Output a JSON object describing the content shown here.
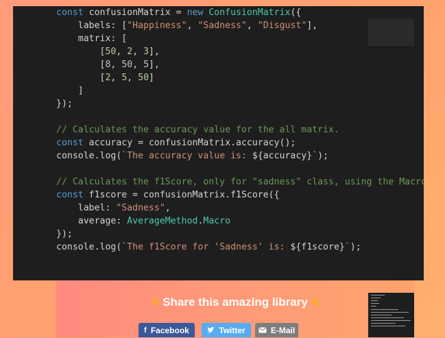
{
  "code": {
    "lines": [
      [
        {
          "t": "const",
          "c": "#569cd6"
        },
        {
          "t": " confusionMatrix = ",
          "c": "#d4d4d4"
        },
        {
          "t": "new",
          "c": "#569cd6"
        },
        {
          "t": " ",
          "c": "#d4d4d4"
        },
        {
          "t": "ConfusionMatrix",
          "c": "#4ec9b0"
        },
        {
          "t": "({",
          "c": "#d4d4d4"
        }
      ],
      [
        {
          "t": "    labels: [",
          "c": "#d4d4d4"
        },
        {
          "t": "\"Happiness\"",
          "c": "#ce9178"
        },
        {
          "t": ", ",
          "c": "#d4d4d4"
        },
        {
          "t": "\"Sadness\"",
          "c": "#ce9178"
        },
        {
          "t": ", ",
          "c": "#d4d4d4"
        },
        {
          "t": "\"Disgust\"",
          "c": "#ce9178"
        },
        {
          "t": "],",
          "c": "#d4d4d4"
        }
      ],
      [
        {
          "t": "    matrix: [",
          "c": "#d4d4d4"
        }
      ],
      [
        {
          "t": "        [",
          "c": "#d4d4d4"
        },
        {
          "t": "50",
          "c": "#b5cea8"
        },
        {
          "t": ", ",
          "c": "#d4d4d4"
        },
        {
          "t": "2",
          "c": "#b5cea8"
        },
        {
          "t": ", ",
          "c": "#d4d4d4"
        },
        {
          "t": "3",
          "c": "#b5cea8"
        },
        {
          "t": "],",
          "c": "#d4d4d4"
        }
      ],
      [
        {
          "t": "        [",
          "c": "#d4d4d4"
        },
        {
          "t": "8",
          "c": "#b5cea8"
        },
        {
          "t": ", ",
          "c": "#d4d4d4"
        },
        {
          "t": "50",
          "c": "#b5cea8"
        },
        {
          "t": ", ",
          "c": "#d4d4d4"
        },
        {
          "t": "5",
          "c": "#b5cea8"
        },
        {
          "t": "],",
          "c": "#d4d4d4"
        }
      ],
      [
        {
          "t": "        [",
          "c": "#d4d4d4"
        },
        {
          "t": "2",
          "c": "#b5cea8"
        },
        {
          "t": ", ",
          "c": "#d4d4d4"
        },
        {
          "t": "5",
          "c": "#b5cea8"
        },
        {
          "t": ", ",
          "c": "#d4d4d4"
        },
        {
          "t": "50",
          "c": "#b5cea8"
        },
        {
          "t": "]",
          "c": "#d4d4d4"
        }
      ],
      [
        {
          "t": "    ]",
          "c": "#d4d4d4"
        }
      ],
      [
        {
          "t": "});",
          "c": "#d4d4d4"
        }
      ],
      [],
      [
        {
          "t": "// Calculates the accuracy value for the all matrix.",
          "c": "#6a9955"
        }
      ],
      [
        {
          "t": "const",
          "c": "#569cd6"
        },
        {
          "t": " accuracy = confusionMatrix.accuracy();",
          "c": "#d4d4d4"
        }
      ],
      [
        {
          "t": "console.log(",
          "c": "#d4d4d4"
        },
        {
          "t": "`The accuracy value is: ",
          "c": "#ce9178"
        },
        {
          "t": "${accuracy}",
          "c": "#d4d4d4"
        },
        {
          "t": "`",
          "c": "#ce9178"
        },
        {
          "t": ");",
          "c": "#d4d4d4"
        }
      ],
      [],
      [
        {
          "t": "// Calculates the f1Score, only for \"sadness\" class, using the Macro",
          "c": "#6a9955"
        }
      ],
      [
        {
          "t": "const",
          "c": "#569cd6"
        },
        {
          "t": " f1score = confusionMatrix.f1Score({",
          "c": "#d4d4d4"
        }
      ],
      [
        {
          "t": "    label: ",
          "c": "#d4d4d4"
        },
        {
          "t": "\"Sadness\"",
          "c": "#ce9178"
        },
        {
          "t": ",",
          "c": "#d4d4d4"
        }
      ],
      [
        {
          "t": "    average: ",
          "c": "#d4d4d4"
        },
        {
          "t": "AverageMethod",
          "c": "#4ec9b0"
        },
        {
          "t": ".",
          "c": "#d4d4d4"
        },
        {
          "t": "Macro",
          "c": "#4ec9b0"
        }
      ],
      [
        {
          "t": "});",
          "c": "#d4d4d4"
        }
      ],
      [
        {
          "t": "console.log(",
          "c": "#d4d4d4"
        },
        {
          "t": "`The f1Score for 'Sadness' is: ",
          "c": "#ce9178"
        },
        {
          "t": "${f1score}",
          "c": "#d4d4d4"
        },
        {
          "t": "`",
          "c": "#ce9178"
        },
        {
          "t": ");",
          "c": "#d4d4d4"
        }
      ]
    ]
  },
  "share": {
    "heading": "Share this amazing library",
    "hand_icon": "pointing-down-hand-icon",
    "facebook_label": "Facebook",
    "twitter_label": "Twitter",
    "email_label": "E-Mail",
    "facebook_color": "#3b5998",
    "twitter_color": "#55acee",
    "email_color": "#7d7d7d"
  }
}
